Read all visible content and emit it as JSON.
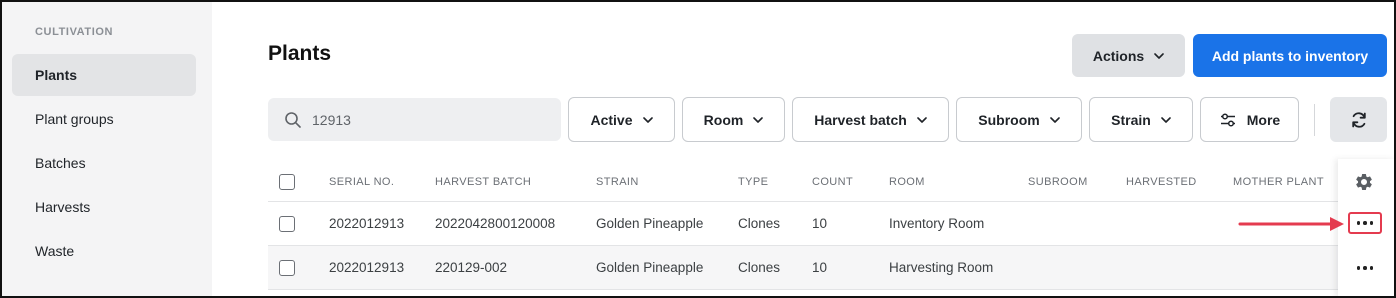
{
  "sidebar": {
    "section": "CULTIVATION",
    "items": [
      {
        "label": "Plants",
        "active": true
      },
      {
        "label": "Plant groups"
      },
      {
        "label": "Batches"
      },
      {
        "label": "Harvests"
      },
      {
        "label": "Waste"
      }
    ]
  },
  "header": {
    "title": "Plants",
    "actions_label": "Actions",
    "add_label": "Add plants to inventory"
  },
  "search": {
    "value": "12913"
  },
  "filters": [
    "Active",
    "Room",
    "Harvest batch",
    "Subroom",
    "Strain",
    "More"
  ],
  "table": {
    "columns": [
      "SERIAL NO.",
      "HARVEST BATCH",
      "STRAIN",
      "TYPE",
      "COUNT",
      "ROOM",
      "SUBROOM",
      "HARVESTED",
      "MOTHER PLANT"
    ],
    "rows": [
      [
        "2022012913",
        "2022042800120008",
        "Golden Pineapple",
        "Clones",
        "10",
        "Inventory Room",
        "",
        "",
        ""
      ],
      [
        "2022012913",
        "220129-002",
        "Golden Pineapple",
        "Clones",
        "10",
        "Harvesting Room",
        "",
        "",
        ""
      ]
    ]
  },
  "colors": {
    "primary": "#1a73e8",
    "highlight": "#e43b4f",
    "sidebar_bg": "#f4f4f5"
  }
}
